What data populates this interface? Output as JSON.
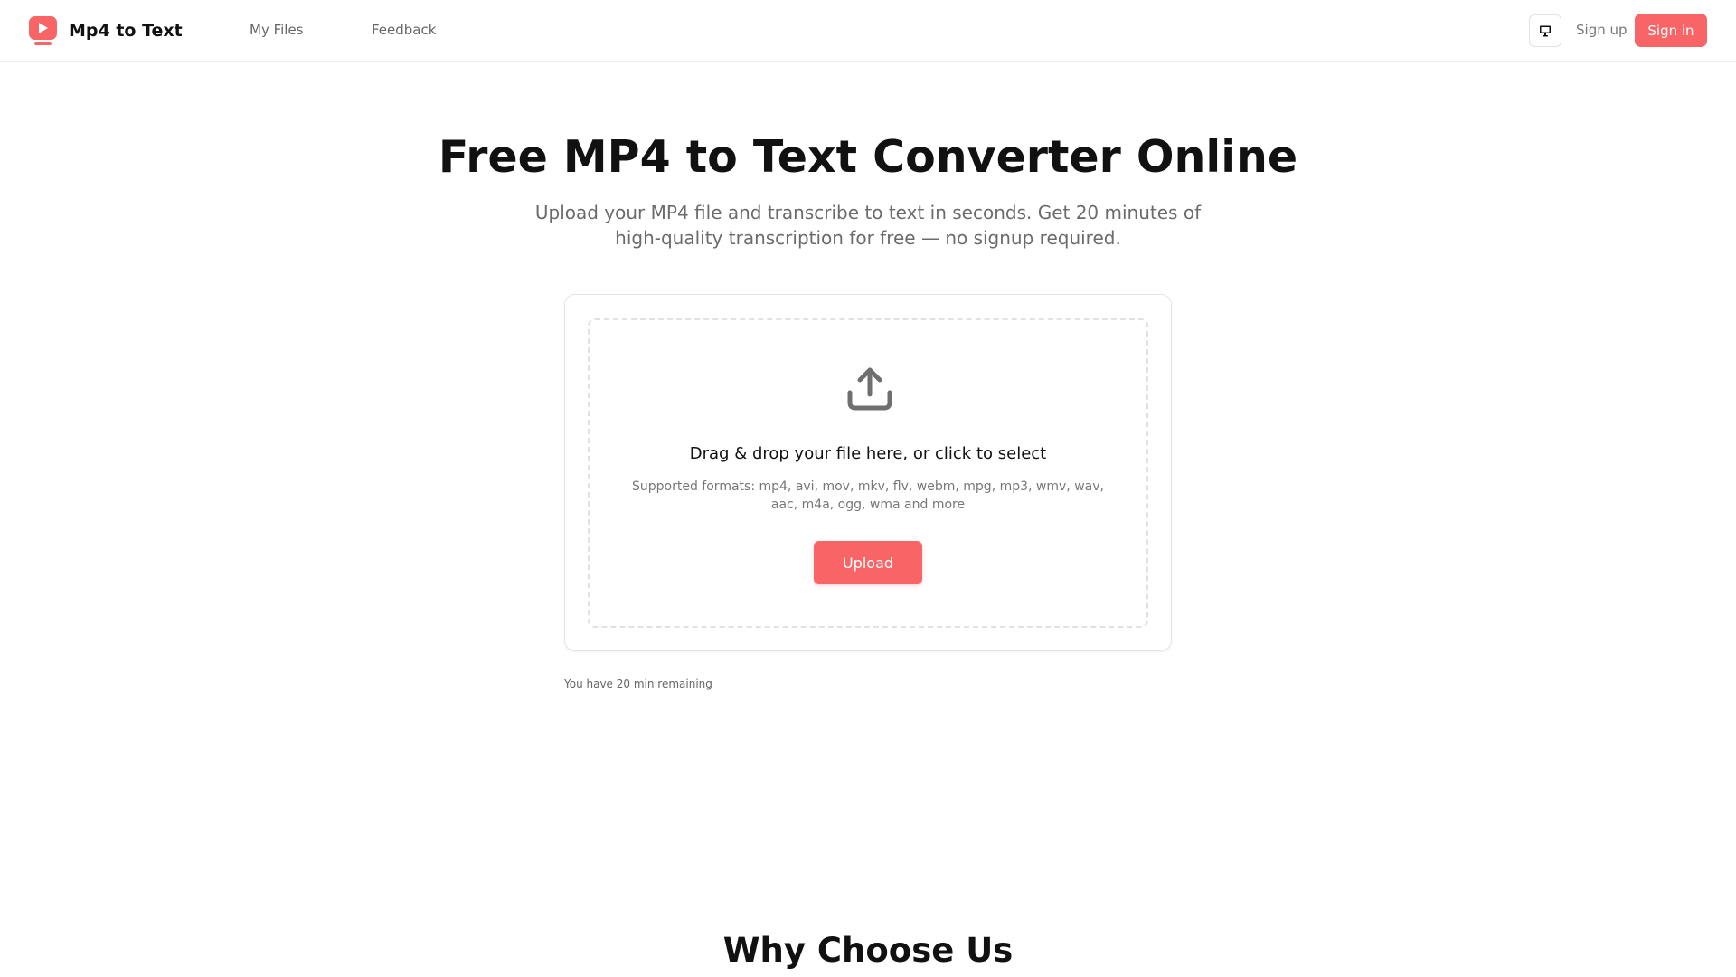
{
  "header": {
    "brand_name": "Mp4 to Text",
    "nav": {
      "my_files": "My Files",
      "feedback": "Feedback"
    },
    "theme_toggle_icon": "monitor-icon",
    "signup_label": "Sign up",
    "signin_label": "Sign in"
  },
  "hero": {
    "title": "Free MP4 to Text Converter Online",
    "subtitle": "Upload your MP4 file and transcribe to text in seconds. Get 20 minutes of high-quality transcription for free — no signup required."
  },
  "uploader": {
    "icon": "upload-icon",
    "drop_text": "Drag & drop your file here, or click to select",
    "formats_text": "Supported formats: mp4, avi, mov, mkv, flv, webm, mpg, mp3, wmv, wav, aac, m4a, ogg, wma and more",
    "button_label": "Upload"
  },
  "quota": {
    "remaining_text": "You have 20 min remaining"
  },
  "section": {
    "why_title": "Why Choose Us"
  },
  "colors": {
    "accent": "#f96466",
    "logo_dark": "#d73e40"
  }
}
